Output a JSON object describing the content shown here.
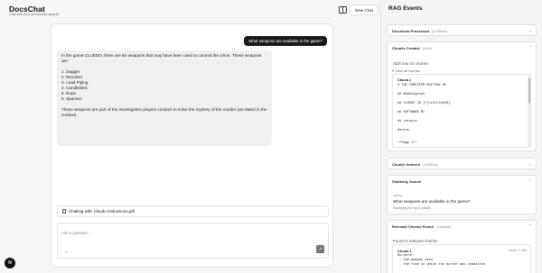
{
  "app": {
    "title": "DocsChat",
    "subtitle": "Chat with your documents using AI",
    "new_chat": "New Chat"
  },
  "chat": {
    "user_message": "What weapons are available in the game?",
    "assistant": {
      "intro": "In the game CLUEDO, there are six weapons that may have been used to commit the crime. These weapons are:",
      "list": [
        "1. Dagger",
        "2. Revolver",
        "3. Lead Piping",
        "4. Candlestick",
        "5. Rope",
        "6. Spanner"
      ],
      "outro": "These weapons are part of the investigation players conduct to solve the mystery of the murder (as stated in the context)."
    },
    "chatting_with": "Chatting with: Cluedo Instructions.pdf",
    "input_placeholder": "Ask a question...",
    "input_marker": "↵",
    "send_icon": "↗",
    "avatar_letter": "N"
  },
  "rag": {
    "title": "RAG Events",
    "document_processed": {
      "name": "Document Processed",
      "meta": "(2769ms)"
    },
    "chunks_created": {
      "name": "Chunks Created",
      "meta": "(1ms)",
      "summary": "Split into 10 chunks",
      "view_all": "▾ View all chunks",
      "chunk_label": "Chunk 1",
      "lines": [
        "# THE COMPUTER EDITION OF",
        "## Waddingtons",
        "## CLUEDO ($ ]^{\\circled{R}",
        "## SOFTWARE BY",
        "## Leisure",
        "Genius",
        "...",
        "**Page 1**"
      ]
    },
    "chunks_indexed": {
      "name": "Chunks Indexed",
      "meta": "(1939ms)"
    },
    "similarity_search": {
      "name": "Similarity Search",
      "query_label": "Query:",
      "query": "What weapons are available in the game?",
      "searching": "Searching for top 5 results"
    },
    "relevant_chunks": {
      "name": "Relevant Chunks Found",
      "meta": "(1188ms)",
      "summary": "Found 5 relevant chunks",
      "chunk_label": "Chunk 1",
      "score": "Score: 0.255",
      "lines": [
        "Murderer",
        " - the weapon used",
        " - the room in which the murder was committed"
      ]
    }
  }
}
